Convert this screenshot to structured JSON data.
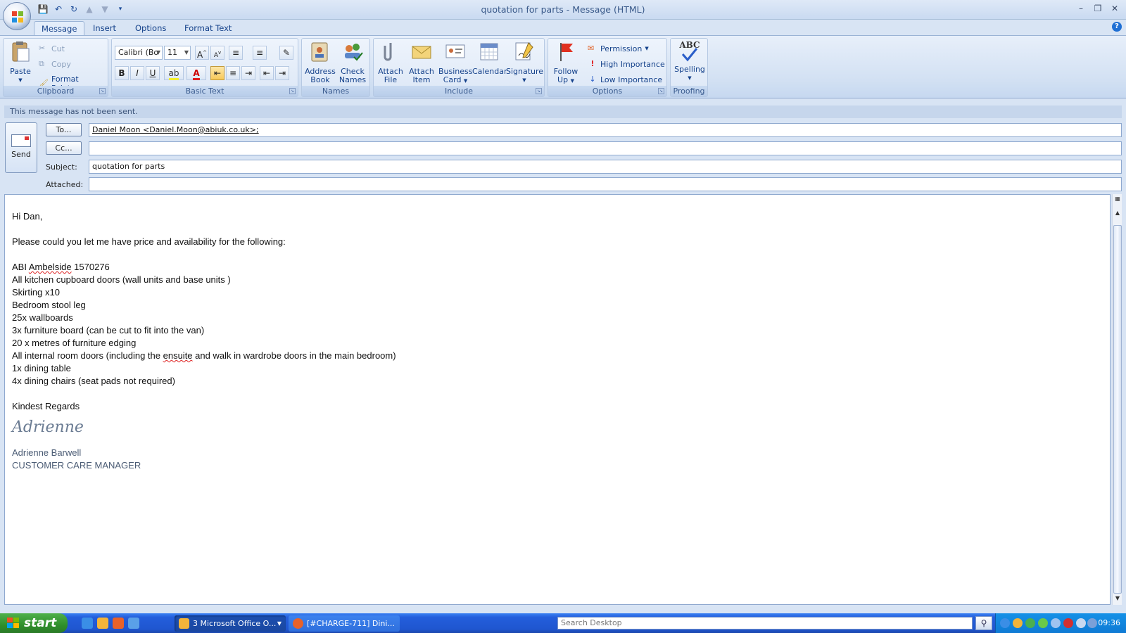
{
  "window": {
    "title": "quotation for parts - Message (HTML)"
  },
  "tabs": [
    "Message",
    "Insert",
    "Options",
    "Format Text"
  ],
  "ribbon": {
    "clipboard": {
      "label": "Clipboard",
      "paste": "Paste",
      "cut": "Cut",
      "copy": "Copy",
      "format_painter": "Format Painter"
    },
    "basic_text": {
      "label": "Basic Text",
      "font": "Calibri (Bo",
      "size": "11",
      "bold": "B",
      "italic": "I",
      "underline": "U"
    },
    "names": {
      "label": "Names",
      "address_book_1": "Address",
      "address_book_2": "Book",
      "check_names_1": "Check",
      "check_names_2": "Names"
    },
    "include": {
      "label": "Include",
      "attach_file_1": "Attach",
      "attach_file_2": "File",
      "attach_item_1": "Attach",
      "attach_item_2": "Item",
      "business_card_1": "Business",
      "business_card_2": "Card",
      "calendar": "Calendar",
      "signature": "Signature"
    },
    "options": {
      "label": "Options",
      "follow_up_1": "Follow",
      "follow_up_2": "Up",
      "permission": "Permission",
      "high_importance": "High Importance",
      "low_importance": "Low Importance"
    },
    "proofing": {
      "label": "Proofing",
      "spelling": "Spelling",
      "abc": "ABC"
    }
  },
  "infobar": "This message has not been sent.",
  "header": {
    "send": "Send",
    "to_button": "To...",
    "cc_button": "Cc...",
    "subject_label": "Subject:",
    "attached_label": "Attached:",
    "to_value": "Daniel Moon <Daniel.Moon@abiuk.co.uk>;",
    "cc_value": "",
    "subject_value": "quotation for parts",
    "attached_value": ""
  },
  "body": {
    "greeting": "Hi Dan,",
    "intro": "Please could you let me have price and availability for the following:",
    "ref_prefix": "ABI ",
    "ref_word": "Ambelside",
    "ref_suffix": " 1570276",
    "items": [
      "All kitchen cupboard doors (wall units and base units )",
      "Skirting x10",
      "Bedroom stool leg",
      "25x wallboards",
      "3x furniture board (can be cut to fit into the van)",
      "20 x metres of furniture edging"
    ],
    "doors_prefix": "All internal room doors (including the ",
    "doors_word": "ensuite",
    "doors_suffix": " and walk in wardrobe doors in the main bedroom)",
    "items2": [
      "1x dining table",
      "4x dining chairs (seat pads not required)"
    ],
    "closing": "Kindest Regards",
    "signature_script": "Adrienne",
    "sender_name": "Adrienne Barwell",
    "sender_title": "CUSTOMER CARE MANAGER"
  },
  "taskbar": {
    "start": "start",
    "tasks": [
      "3 Microsoft Office O...",
      "[#CHARGE-711] Dini..."
    ],
    "search_placeholder": "Search Desktop",
    "clock": "09:36"
  },
  "colors": {
    "accent": "#15428b",
    "ribbon": "#d3e1f3",
    "taskbar": "#245edb",
    "start": "#2f8f2b"
  }
}
